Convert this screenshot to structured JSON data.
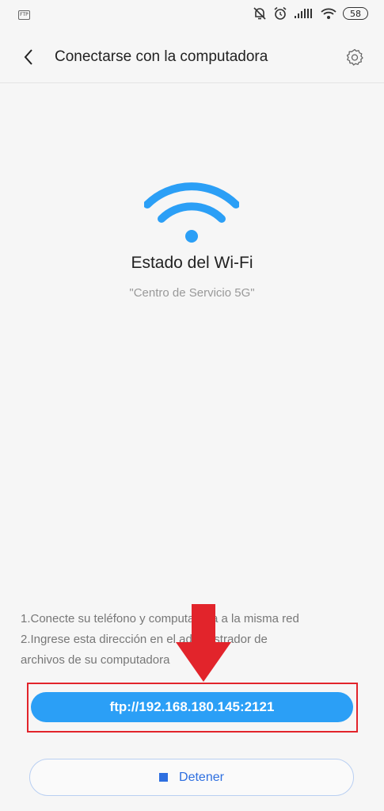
{
  "status_bar": {
    "ftp_badge": "FTP",
    "battery": "58"
  },
  "header": {
    "title": "Conectarse con la computadora"
  },
  "wifi_status": {
    "title": "Estado del Wi-Fi",
    "network_name": "\"Centro de Servicio 5G\""
  },
  "instructions": {
    "line1": "1.Conecte su teléfono y computadora a la misma red",
    "line2": "2.Ingrese esta dirección en el administrador de",
    "line3": "archivos de su computadora"
  },
  "ftp_address": "ftp://192.168.180.145:2121",
  "stop_button": {
    "label": "Detener"
  },
  "colors": {
    "accent": "#2b9ff6",
    "stop_blue": "#2e6fe0",
    "annotation_red": "#e2242b"
  }
}
